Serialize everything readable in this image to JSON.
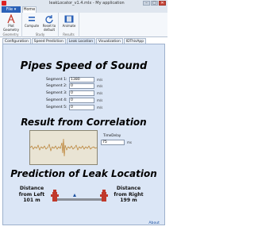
{
  "window": {
    "title": "leakLocator_v1.4.mlx - My application",
    "controls": [
      "–",
      "□",
      "✕"
    ]
  },
  "ribbon": {
    "file_label": "File ▾",
    "home_tab": "Home",
    "groups": [
      {
        "label": "Geometry",
        "buttons": [
          {
            "label": "Plot Geometry",
            "icon": "plot-icon"
          }
        ]
      },
      {
        "label": "Study",
        "buttons": [
          {
            "label": "Compute",
            "icon": "compute-icon"
          },
          {
            "label": "Reset to default",
            "icon": "reset-icon"
          }
        ]
      },
      {
        "label": "Results",
        "buttons": [
          {
            "label": "Animate",
            "icon": "film-icon"
          }
        ]
      }
    ]
  },
  "tabs": [
    "Configuration",
    "Speed Prediction",
    "Leak Location",
    "Visualization",
    "IDThisApp"
  ],
  "active_tab": "Leak Location",
  "sections": {
    "speed_title": "Pipes Speed of Sound",
    "correlation_title": "Result from Correlation",
    "prediction_title": "Prediction of Leak Location"
  },
  "segments": [
    {
      "label": "Segment 1:",
      "value": "1380",
      "unit": "m/s"
    },
    {
      "label": "Segment 2:",
      "value": "0",
      "unit": "m/s"
    },
    {
      "label": "Segment 3:",
      "value": "0",
      "unit": "m/s"
    },
    {
      "label": "Segment 4:",
      "value": "0",
      "unit": "m/s"
    },
    {
      "label": "Segment 5:",
      "value": "0",
      "unit": "m/s"
    }
  ],
  "time_delay": {
    "label": "TimeDelay",
    "value": "75",
    "unit": "ms"
  },
  "distance_left": {
    "line1": "Distance",
    "line2": "from Left",
    "value": "101 m"
  },
  "distance_right": {
    "line1": "Distance",
    "line2": "from Right",
    "value": "199 m"
  },
  "about_label": "About",
  "colors": {
    "accent": "#2a61b8",
    "panel": "#dbe6f6",
    "hydrant": "#c0392b",
    "signal": "#b5731c"
  }
}
